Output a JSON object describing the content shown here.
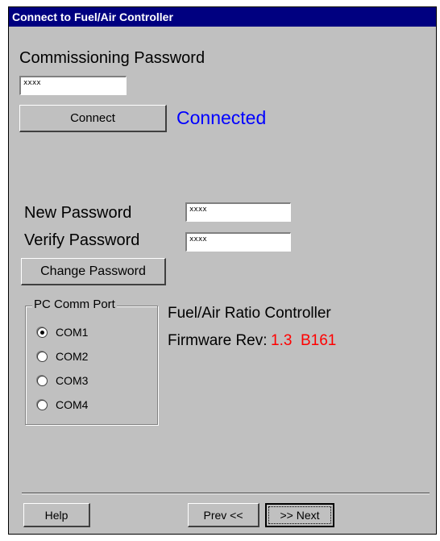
{
  "window": {
    "title": "Connect to Fuel/Air Controller"
  },
  "commissioning": {
    "label": "Commissioning Password",
    "password_value": "xxxx",
    "connect_label": "Connect",
    "status_text": "Connected",
    "status_color": "#0000ff"
  },
  "password_change": {
    "new_label": "New Password",
    "new_value": "xxxx",
    "verify_label": "Verify Password",
    "verify_value": "xxxx",
    "change_label": "Change Password"
  },
  "comm_port": {
    "legend": "PC Comm Port",
    "options": [
      {
        "label": "COM1",
        "selected": true
      },
      {
        "label": "COM2",
        "selected": false
      },
      {
        "label": "COM3",
        "selected": false
      },
      {
        "label": "COM4",
        "selected": false
      }
    ]
  },
  "device": {
    "name": "Fuel/Air Ratio Controller",
    "firmware_label": "Firmware Rev:",
    "firmware_value": "1.3  B161",
    "firmware_color": "#ff0000"
  },
  "footer": {
    "help_label": "Help",
    "prev_label": "Prev <<",
    "next_label": ">> Next"
  }
}
